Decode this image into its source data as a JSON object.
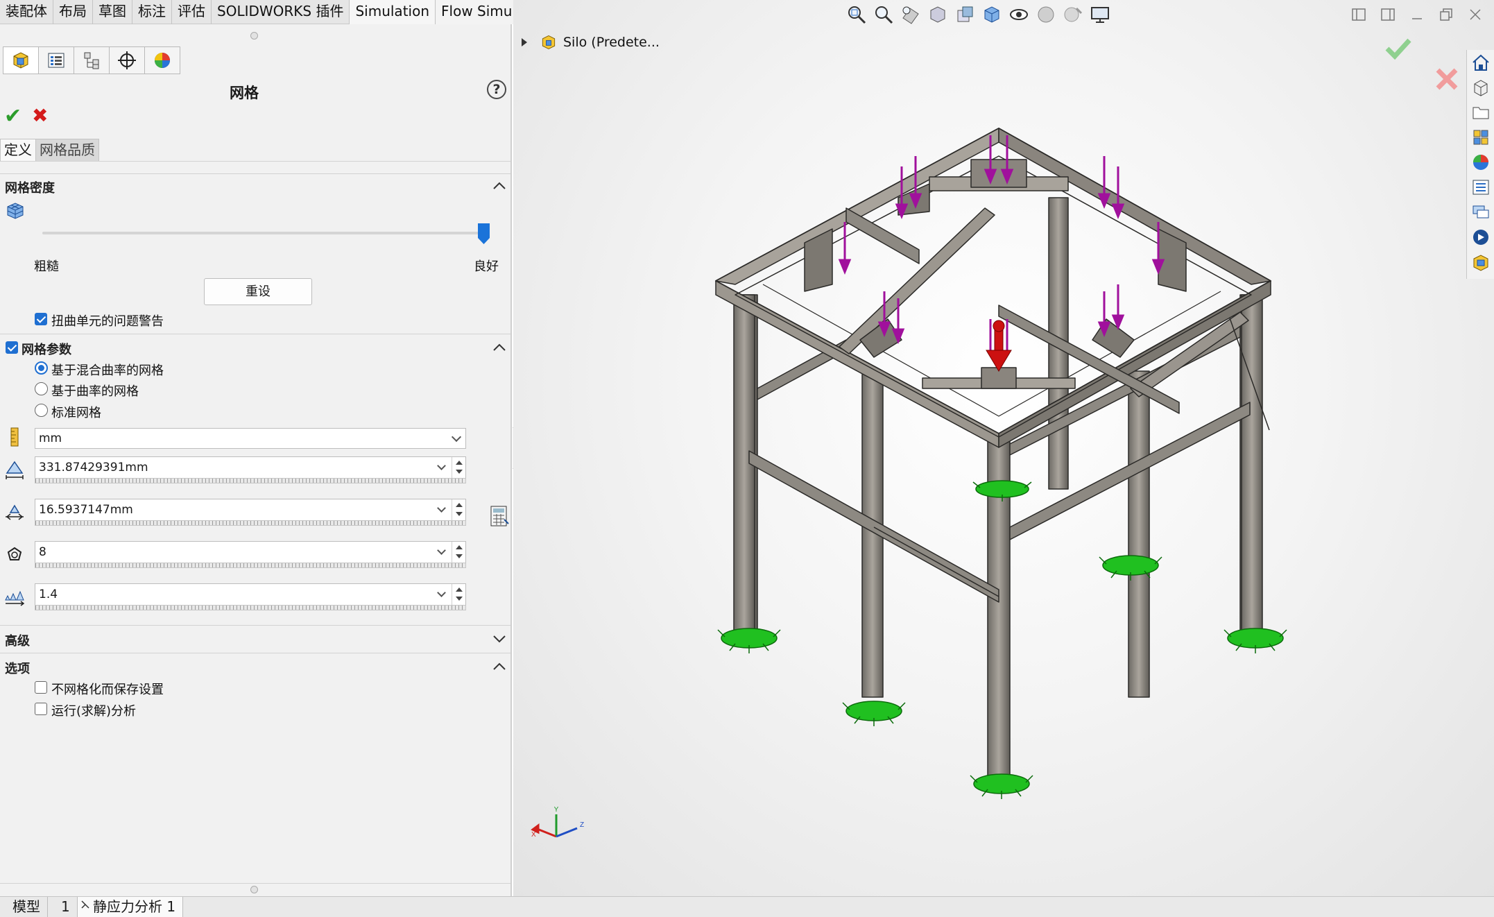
{
  "top_tabs": [
    "装配体",
    "布局",
    "草图",
    "标注",
    "评估",
    "SOLIDWORKS 插件",
    "Simulation",
    "Flow Simulation"
  ],
  "panel": {
    "title": "网格",
    "help_symbol": "?",
    "prop_tabs": {
      "definition": "定义",
      "quality": "网格品质"
    },
    "density": {
      "heading": "网格密度",
      "coarse_label": "粗糙",
      "fine_label": "良好",
      "level_fraction": 1.0,
      "reset_label": "重设",
      "distortion_warning_label": "扭曲单元的问题警告",
      "distortion_warning_checked": true
    },
    "params": {
      "heading": "网格参数",
      "enabled": true,
      "options": [
        "基于混合曲率的网格",
        "基于曲率的网格",
        "标准网格"
      ],
      "selected_index": 0,
      "unit": "mm",
      "max_element_size": "331.87429391mm",
      "min_element_size": "16.5937147mm",
      "min_elements_in_circle": "8",
      "growth_ratio": "1.4"
    },
    "advanced": {
      "heading": "高级"
    },
    "options": {
      "heading": "选项",
      "save_without_meshing_label": "不网格化而保存设置",
      "save_without_meshing_checked": false,
      "run_analysis_label": "运行(求解)分析",
      "run_analysis_checked": false
    }
  },
  "graphics": {
    "tree_root": "Silo (Predete...",
    "triad": {
      "x": "X",
      "y": "Y",
      "z": "Z"
    }
  },
  "bottom_tabs": [
    "模型",
    "1",
    "静应力分析 1"
  ],
  "colors": {
    "accent": "#1f6fd1",
    "ok": "#2c9d2c",
    "cancel": "#d41b1b",
    "steel": "#8a8680",
    "load_arrow": "#a0109c",
    "fixture": "#20c020",
    "gravity": "#cc1111"
  }
}
